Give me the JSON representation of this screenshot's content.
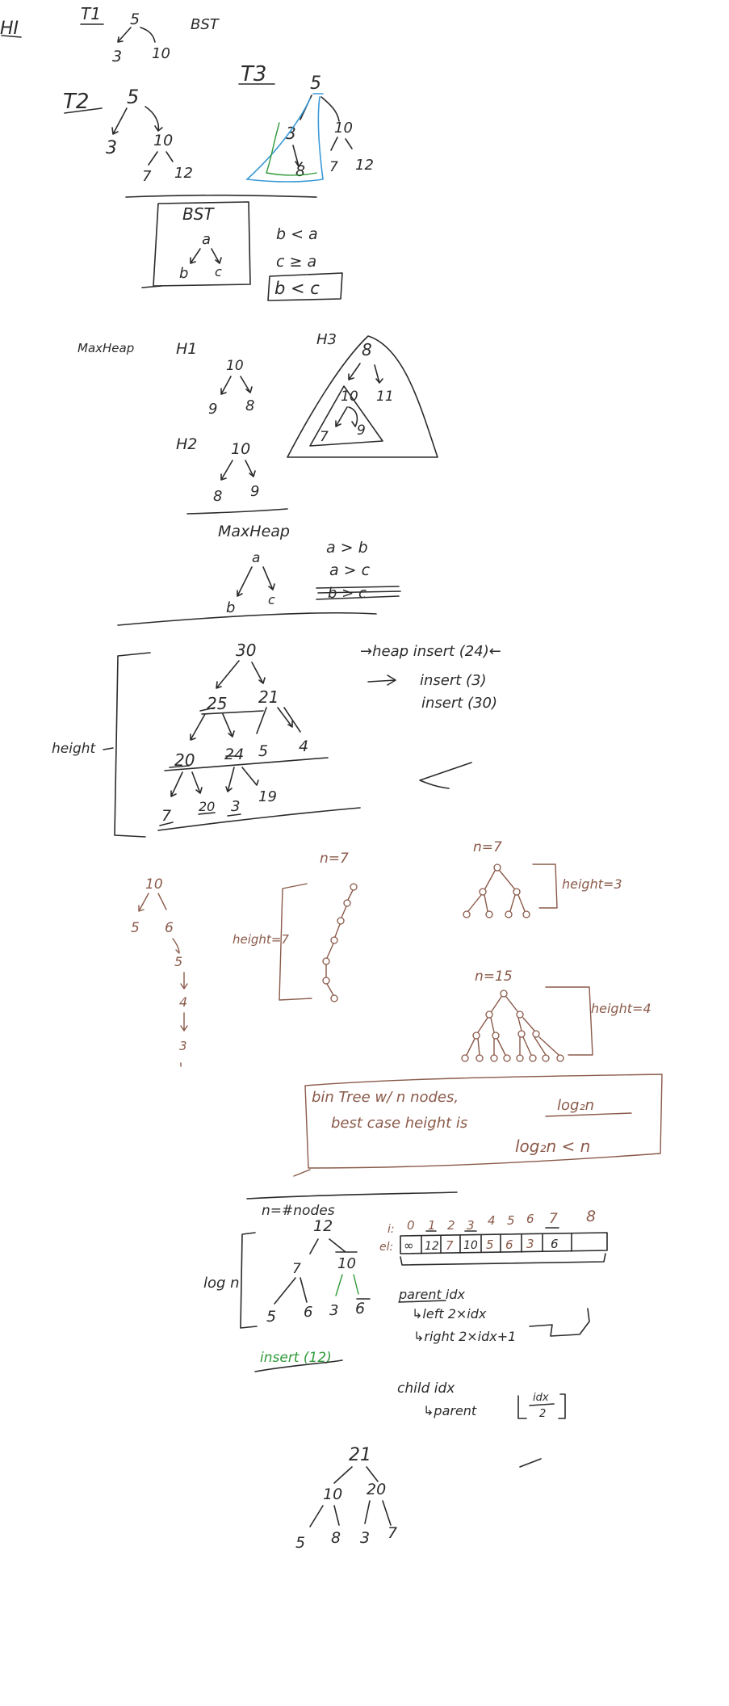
{
  "colors": {
    "black_ink": "#2b2b2b",
    "red_ink": "#8a5a4a",
    "green_ink": "#2f9a3a",
    "blue_ink": "#3a9ad9"
  },
  "top": {
    "corner": "HI",
    "t1_label": "T1",
    "t1_root": "5",
    "t1_left": "3",
    "t1_right": "10",
    "bst_label": "BST",
    "t2_label": "T2",
    "t2_root": "5",
    "t2_left": "3",
    "t2_right": "10",
    "t2_rl": "7",
    "t2_rr": "12",
    "t3_label": "T3",
    "t3_root": "5",
    "t3_left": "3",
    "t3_lr": "8",
    "t3_right": "10",
    "t3_rl": "7",
    "t3_rr": "12"
  },
  "bst_box": {
    "title": "BST",
    "a": "a",
    "b": "b",
    "c": "c",
    "rule1": "b < a",
    "rule2": "c ≥ a",
    "rule3": "b < c"
  },
  "maxheap_examples": {
    "label": "MaxHeap",
    "h1_label": "H1",
    "h1_root": "10",
    "h1_left": "9",
    "h1_right": "8",
    "h2_label": "H2",
    "h2_root": "10",
    "h2_left": "8",
    "h2_right": "9",
    "h3_label": "H3",
    "h3_root": "8",
    "h3_left": "10",
    "h3_right": "11",
    "h3_ll": "7",
    "h3_lr": "9"
  },
  "maxheap_def": {
    "title": "MaxHeap",
    "a": "a",
    "b": "b",
    "c": "c",
    "rule1": "a > b",
    "rule2": "a > c",
    "struck": "b > c"
  },
  "heap_example": {
    "height_label": "height",
    "values": [
      "30",
      "25",
      "21",
      "20",
      "24",
      "5",
      "4",
      "7",
      "20",
      "3",
      "19"
    ],
    "op1": "→heap insert (24)←",
    "op2": "insert (3)",
    "op3": "insert (30)"
  },
  "height_section": {
    "chain": [
      "10",
      "5",
      "6",
      "5",
      "4",
      "3"
    ],
    "n7_label_a": "n=7",
    "height7_label": "height=7",
    "n7_label_b": "n=7",
    "height3_label": "height=3",
    "n15_label": "n=15",
    "height4_label": "height=4",
    "box_line1": "bin Tree  w/ n nodes,",
    "box_line2": "best  case  height  is",
    "box_log": "log₂n",
    "box_line3": "log₂n < n"
  },
  "array_section": {
    "n_label": "n=#nodes",
    "logn_label": "log n",
    "tree": [
      "12",
      "7",
      "10",
      "5",
      "6",
      "3",
      "6"
    ],
    "insert_label": "insert (12)",
    "i_label": "i:",
    "el_label": "el:",
    "indices": [
      "0",
      "1",
      "2",
      "3",
      "4",
      "5",
      "6",
      "7",
      "8"
    ],
    "cells": [
      "∞",
      "12",
      "7",
      "10",
      "5",
      "6",
      "3",
      "6",
      ""
    ],
    "parent_idx": "parent idx",
    "left_rule": "↳left  2×idx",
    "right_rule": "↳right 2×idx+1",
    "child_idx": "child idx",
    "parent_rule": "↳parent",
    "floor_num": "idx",
    "floor_den": "2"
  },
  "final_tree": {
    "values": [
      "21",
      "10",
      "20",
      "5",
      "8",
      "3",
      "7"
    ]
  }
}
